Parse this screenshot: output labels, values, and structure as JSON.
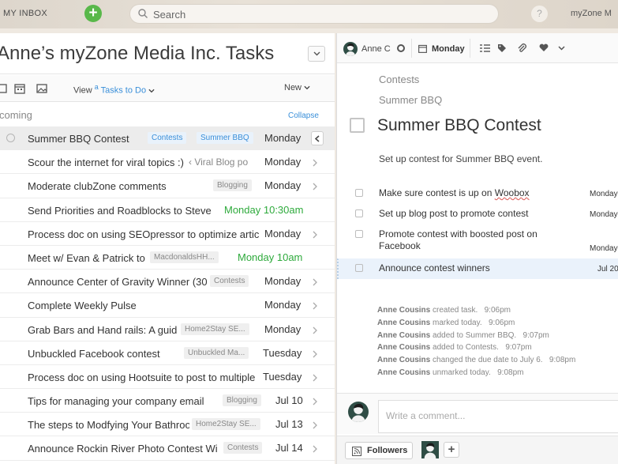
{
  "topbar": {
    "inbox_label": "MY INBOX",
    "search_placeholder": "Search",
    "help_label": "?",
    "brand_label": "myZone M"
  },
  "left": {
    "title": "Anne’s myZone Media Inc. Tasks",
    "view_label": "View",
    "view_sort": "a",
    "view_value": "Tasks to Do",
    "new_label": "New",
    "section_label": "coming",
    "collapse_label": "Collapse",
    "rows": [
      {
        "title": "Summer BBQ Contest",
        "tags": [
          "Contests",
          "Summer BBQ"
        ],
        "date": "Monday",
        "selected": true
      },
      {
        "title": "Scour the internet for viral topics :)",
        "ctx": "‹ Viral Blog po",
        "date": "Monday"
      },
      {
        "title": "Moderate clubZone comments",
        "tags": [
          "Blogging"
        ],
        "date": "Monday"
      },
      {
        "title": "Send Priorities and Roadblocks to Steve",
        "date": "Monday 10:30am",
        "date_color": "#2eaa3c"
      },
      {
        "title": "Process doc on using SEOpressor to optimize artic",
        "date": "Monday"
      },
      {
        "title": "Meet w/ Evan & Patrick to",
        "tags": [
          "MacdonaldsHH..."
        ],
        "date": "Monday 10am",
        "date_color": "#2eaa3c"
      },
      {
        "title": "Announce Center of Gravity Winner (30",
        "tags": [
          "Contests"
        ],
        "date": "Monday"
      },
      {
        "title": "Complete Weekly Pulse",
        "date": "Monday"
      },
      {
        "title": "Grab Bars and Hand rails: A guid",
        "tags": [
          "Home2Stay SE..."
        ],
        "date": "Monday"
      },
      {
        "title": "Unbuckled Facebook contest",
        "tags": [
          "Unbuckled Ma..."
        ],
        "date": "Tuesday"
      },
      {
        "title": "Process doc on using Hootsuite to post to multiple",
        "date": "Tuesday"
      },
      {
        "title": "Tips for managing your company email",
        "tags": [
          "Blogging"
        ],
        "date": "Jul 10"
      },
      {
        "title": "The steps to Modfying Your Bathroo",
        "tags": [
          "Home2Stay SE..."
        ],
        "date": "Jul 13"
      },
      {
        "title": "Announce Rockin River Photo Contest Wi",
        "tags": [
          "Contests"
        ],
        "date": "Jul 14"
      }
    ]
  },
  "right": {
    "assignee": "Anne C",
    "due": "Monday",
    "breadcrumb": [
      "Contests",
      "Summer BBQ"
    ],
    "title": "Summer BBQ Contest",
    "description": "Set up contest for Summer BBQ event.",
    "subtasks": [
      {
        "text_before": "Make sure contest is up on ",
        "text_err": "Woobox",
        "date": "Monday"
      },
      {
        "text": "Set up blog post to promote contest",
        "date": "Monday"
      },
      {
        "text": "Promote contest with boosted post on Facebook",
        "date": "Monday"
      },
      {
        "text": "Announce contest winners",
        "date": "Jul 20",
        "highlighted": true
      }
    ],
    "activity": [
      {
        "who": "Anne Cousins",
        "what": "created task.",
        "time": "9:06pm"
      },
      {
        "who": "Anne Cousins",
        "what": "marked today.",
        "time": "9:06pm"
      },
      {
        "who": "Anne Cousins",
        "what": "added to Summer BBQ.",
        "time": "9:07pm"
      },
      {
        "who": "Anne Cousins",
        "what": "added to Contests.",
        "time": "9:07pm"
      },
      {
        "who": "Anne Cousins",
        "what": "changed the due date to July 6.",
        "time": "9:08pm"
      },
      {
        "who": "Anne Cousins",
        "what": "unmarked today.",
        "time": "9:08pm"
      }
    ],
    "comment_placeholder": "Write a comment...",
    "followers_label": "Followers",
    "add_follower_label": "+"
  },
  "colors": {
    "accent": "#3a8fd9",
    "green": "#2eaa3c",
    "plus": "#59b84a"
  }
}
